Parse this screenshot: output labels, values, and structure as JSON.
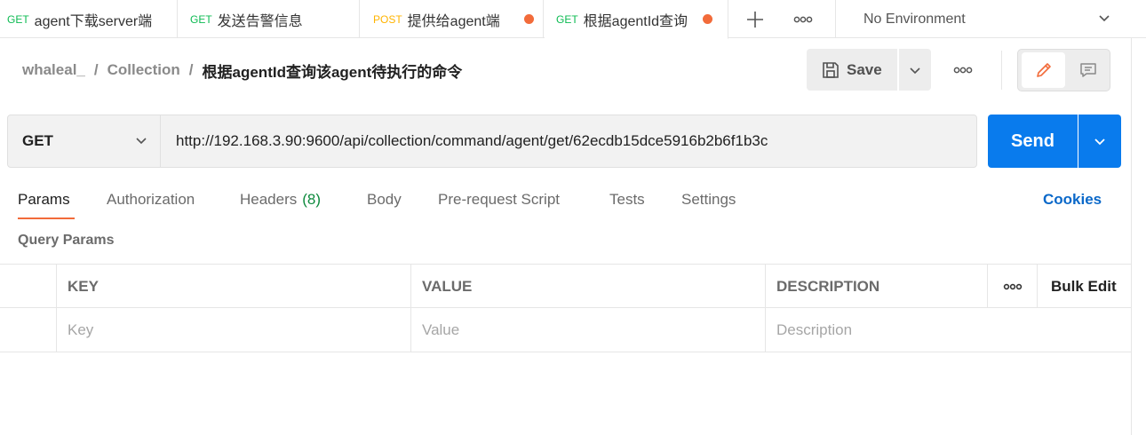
{
  "tabs": [
    {
      "method": "GET",
      "title": "agent下载server端",
      "unsaved": false,
      "active": false
    },
    {
      "method": "GET",
      "title": "发送告警信息",
      "unsaved": false,
      "active": false
    },
    {
      "method": "POST",
      "title": "提供给agent端",
      "unsaved": true,
      "active": false
    },
    {
      "method": "GET",
      "title": "根据agentId查询",
      "unsaved": true,
      "active": true
    }
  ],
  "tab_actions": {
    "new_tab_icon": "plus-icon",
    "more_icon": "more-horizontal-icon"
  },
  "environment": {
    "selected": "No Environment"
  },
  "breadcrumb": {
    "workspace": "whaleal_",
    "collection": "Collection",
    "request": "根据agentId查询该agent待执行的命令",
    "separator": "/"
  },
  "toolbar": {
    "save_label": "Save"
  },
  "request": {
    "method": "GET",
    "url": "http://192.168.3.90:9600/api/collection/command/agent/get/62ecdb15dce5916b2b6f1b3c"
  },
  "send_label": "Send",
  "request_tabs": [
    {
      "label": "Params",
      "active": true
    },
    {
      "label": "Authorization"
    },
    {
      "label": "Headers",
      "count": "(8)"
    },
    {
      "label": "Body"
    },
    {
      "label": "Pre-request Script"
    },
    {
      "label": "Tests"
    },
    {
      "label": "Settings"
    }
  ],
  "cookies_label": "Cookies",
  "query_params": {
    "title": "Query Params",
    "columns": {
      "key": "KEY",
      "value": "VALUE",
      "description": "DESCRIPTION",
      "bulk_edit": "Bulk Edit"
    },
    "placeholders": {
      "key": "Key",
      "value": "Value",
      "description": "Description"
    }
  },
  "colors": {
    "accent": "#f26b3a",
    "send_blue": "#097bed",
    "get_green": "#0cbb52",
    "post_yellow": "#ffb400",
    "link_blue": "#0a68c9"
  }
}
